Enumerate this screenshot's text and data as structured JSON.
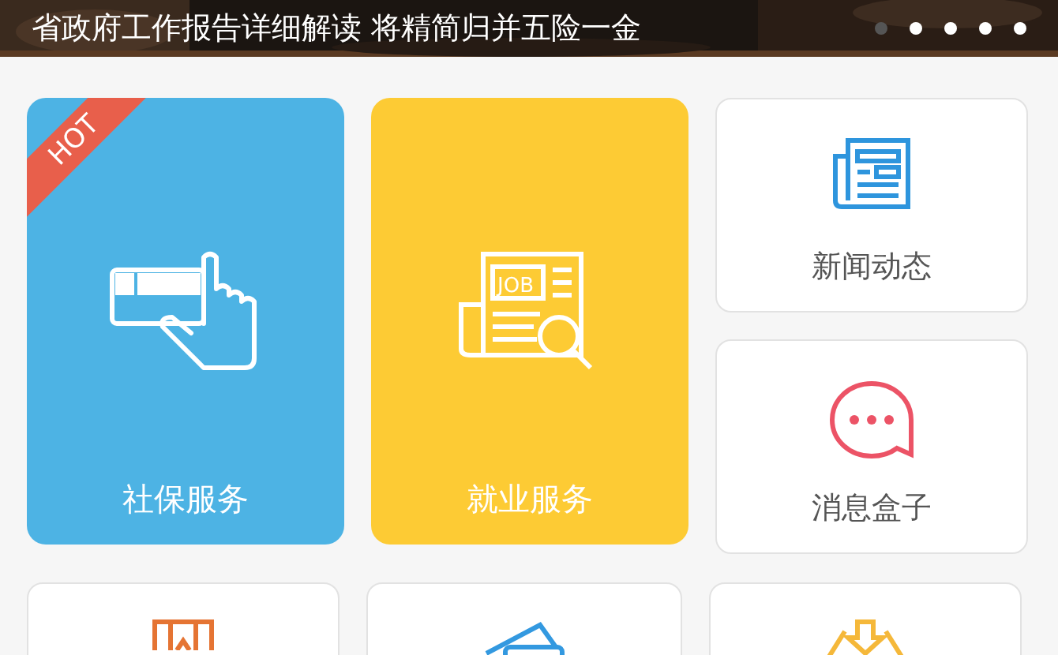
{
  "banner": {
    "headline": "省政府工作报告详细解读 将精简归并五险一金",
    "dots": [
      {
        "selected": true
      },
      {
        "selected": false
      },
      {
        "selected": false
      },
      {
        "selected": false
      },
      {
        "selected": false
      }
    ]
  },
  "tiles": [
    {
      "kind": "large",
      "label": "社保服务",
      "color": "#4db3e4",
      "badge": "HOT"
    },
    {
      "kind": "large",
      "label": "就业服务",
      "color": "#fdcb34",
      "icon_text": "JOB"
    },
    {
      "kind": "small",
      "label": "新闻动态",
      "color": "#2e95dd"
    },
    {
      "kind": "small",
      "label": "消息盒子",
      "color": "#ec5366"
    }
  ],
  "bottom_tiles": [
    {
      "color": "#e57433"
    },
    {
      "color": "#3399e0"
    },
    {
      "color": "#f5b83a"
    }
  ]
}
